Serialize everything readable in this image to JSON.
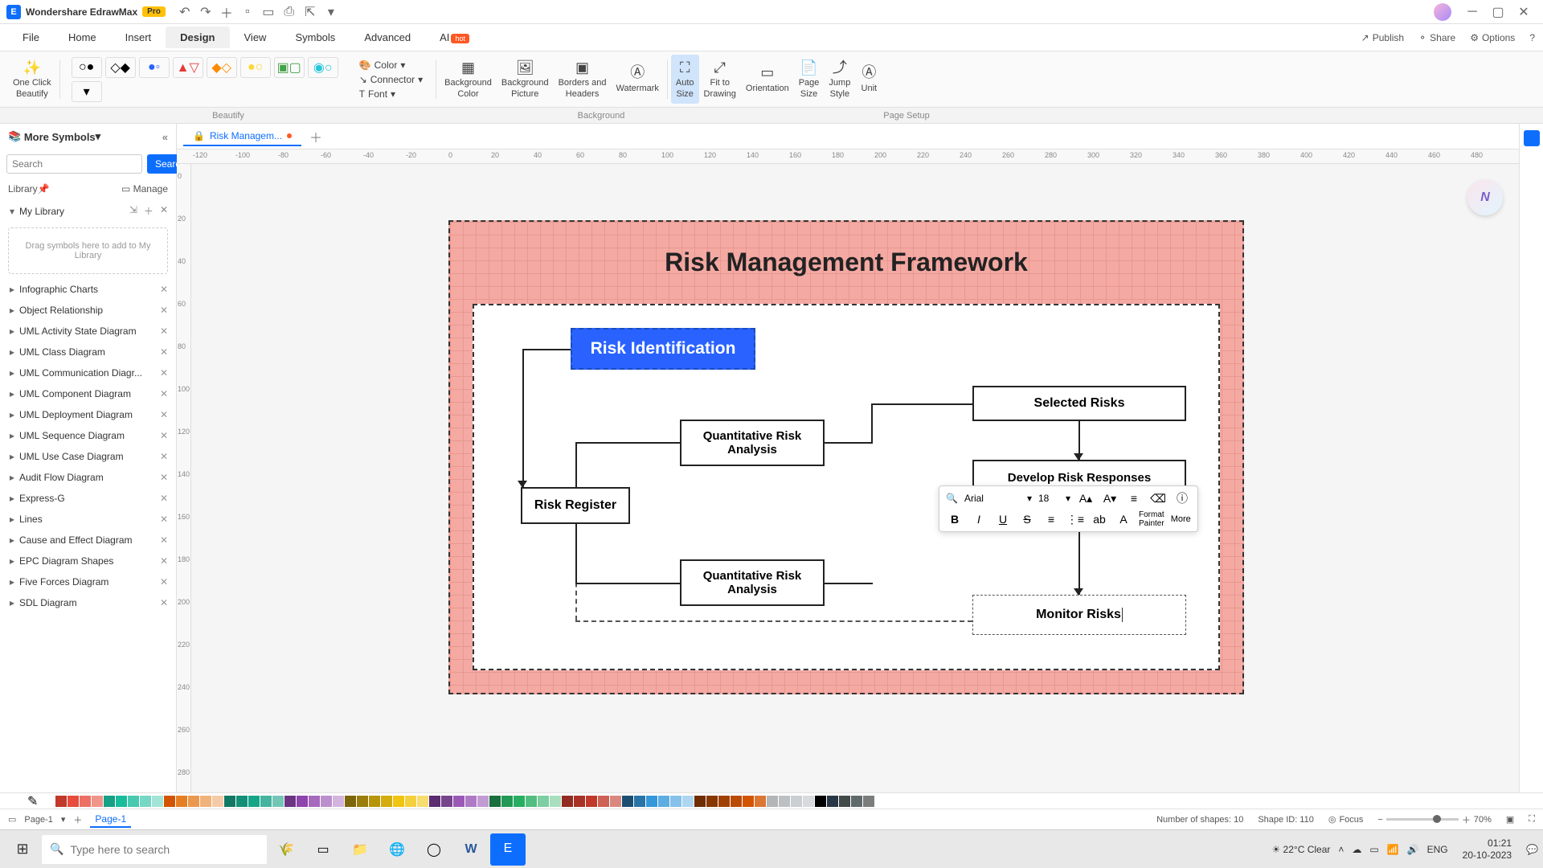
{
  "titlebar": {
    "app_name": "Wondershare EdrawMax",
    "pro": "Pro"
  },
  "menu": {
    "items": [
      "File",
      "Home",
      "Insert",
      "Design",
      "View",
      "Symbols",
      "Advanced",
      "AI"
    ],
    "active": "Design",
    "hot": "hot",
    "right": {
      "publish": "Publish",
      "share": "Share",
      "options": "Options"
    }
  },
  "ribbon": {
    "one_click": "One Click\nBeautify",
    "color": "Color",
    "connector": "Connector",
    "font": "Font",
    "bg_color": "Background\nColor",
    "bg_pic": "Background\nPicture",
    "borders": "Borders and\nHeaders",
    "watermark": "Watermark",
    "auto_size": "Auto\nSize",
    "fit": "Fit to\nDrawing",
    "orientation": "Orientation",
    "page_size": "Page\nSize",
    "jump_style": "Jump\nStyle",
    "unit": "Unit",
    "labels": {
      "beautify": "Beautify",
      "background": "Background",
      "page_setup": "Page Setup"
    }
  },
  "sidebar": {
    "title": "More Symbols",
    "search_ph": "Search",
    "search_btn": "Search",
    "library": "Library",
    "manage": "Manage",
    "my_library": "My Library",
    "drop_hint": "Drag symbols here to add to My Library",
    "categories": [
      "Infographic Charts",
      "Object Relationship",
      "UML Activity State Diagram",
      "UML Class Diagram",
      "UML Communication Diagr...",
      "UML Component Diagram",
      "UML Deployment Diagram",
      "UML Sequence Diagram",
      "UML Use Case Diagram",
      "Audit Flow Diagram",
      "Express-G",
      "Lines",
      "Cause and Effect Diagram",
      "EPC Diagram Shapes",
      "Five Forces Diagram",
      "SDL Diagram"
    ]
  },
  "doc_tab": {
    "name": "Risk Managem...",
    "page_tab": "Page-1",
    "page_select": "Page-1"
  },
  "diagram": {
    "title": "Risk Management Framework",
    "risk_id": "Risk Identification",
    "q1": "Quantitative Risk Analysis",
    "q2": "Quantitative Risk Analysis",
    "register": "Risk Register",
    "selected": "Selected Risks",
    "develop": "Develop Risk Responses",
    "monitor": "Monitor Risks"
  },
  "float_toolbar": {
    "font": "Arial",
    "size": "18",
    "format_painter": "Format\nPainter",
    "more": "More"
  },
  "ruler_ticks": [
    "-120",
    "-100",
    "-80",
    "-60",
    "-40",
    "-20",
    "0",
    "20",
    "40",
    "60",
    "80",
    "100",
    "120",
    "140",
    "160",
    "180",
    "200",
    "220",
    "240",
    "260",
    "280",
    "300",
    "320",
    "340",
    "360",
    "380",
    "400",
    "420",
    "440",
    "460",
    "480"
  ],
  "ruler_v_ticks": [
    "0",
    "20",
    "40",
    "60",
    "80",
    "100",
    "120",
    "140",
    "160",
    "180",
    "200",
    "220",
    "240",
    "260",
    "280"
  ],
  "colors": [
    "#ffffff",
    "#c0392b",
    "#e74c3c",
    "#ec7063",
    "#f1948a",
    "#16a085",
    "#1abc9c",
    "#48c9b0",
    "#76d7c4",
    "#a3e4d7",
    "#d35400",
    "#e67e22",
    "#eb984e",
    "#f0b27a",
    "#f5cba7",
    "#117864",
    "#148f77",
    "#17a589",
    "#45b39d",
    "#73c6b6",
    "#6c3483",
    "#8e44ad",
    "#a569bd",
    "#bb8fce",
    "#d2b4de",
    "#7d6608",
    "#9a7d0a",
    "#b7950b",
    "#d4ac0d",
    "#f1c40f",
    "#f4d03f",
    "#f7dc6f",
    "#5b2c6f",
    "#76448a",
    "#9b59b6",
    "#af7ac5",
    "#c39bd3",
    "#196f3d",
    "#229954",
    "#27ae60",
    "#52be80",
    "#7dcea0",
    "#a9dfbf",
    "#922b21",
    "#a93226",
    "#c0392b",
    "#cd6155",
    "#d98880",
    "#1b4f72",
    "#2874a6",
    "#3498db",
    "#5dade2",
    "#85c1e9",
    "#aed6f1",
    "#6e2c00",
    "#873600",
    "#a04000",
    "#ba4a00",
    "#d35400",
    "#dc7633",
    "#b3b6b7",
    "#bdc0c2",
    "#cacfd2",
    "#d7dbdd",
    "#000000",
    "#273746",
    "#424949",
    "#616a6b",
    "#7b7d7d"
  ],
  "status": {
    "shapes": "Number of shapes: 10",
    "shape_id": "Shape ID: 110",
    "focus": "Focus",
    "zoom": "70%"
  },
  "taskbar": {
    "search_ph": "Type here to search",
    "weather": "22°C  Clear",
    "lang": "ENG",
    "time": "01:21",
    "date": "20-10-2023"
  }
}
